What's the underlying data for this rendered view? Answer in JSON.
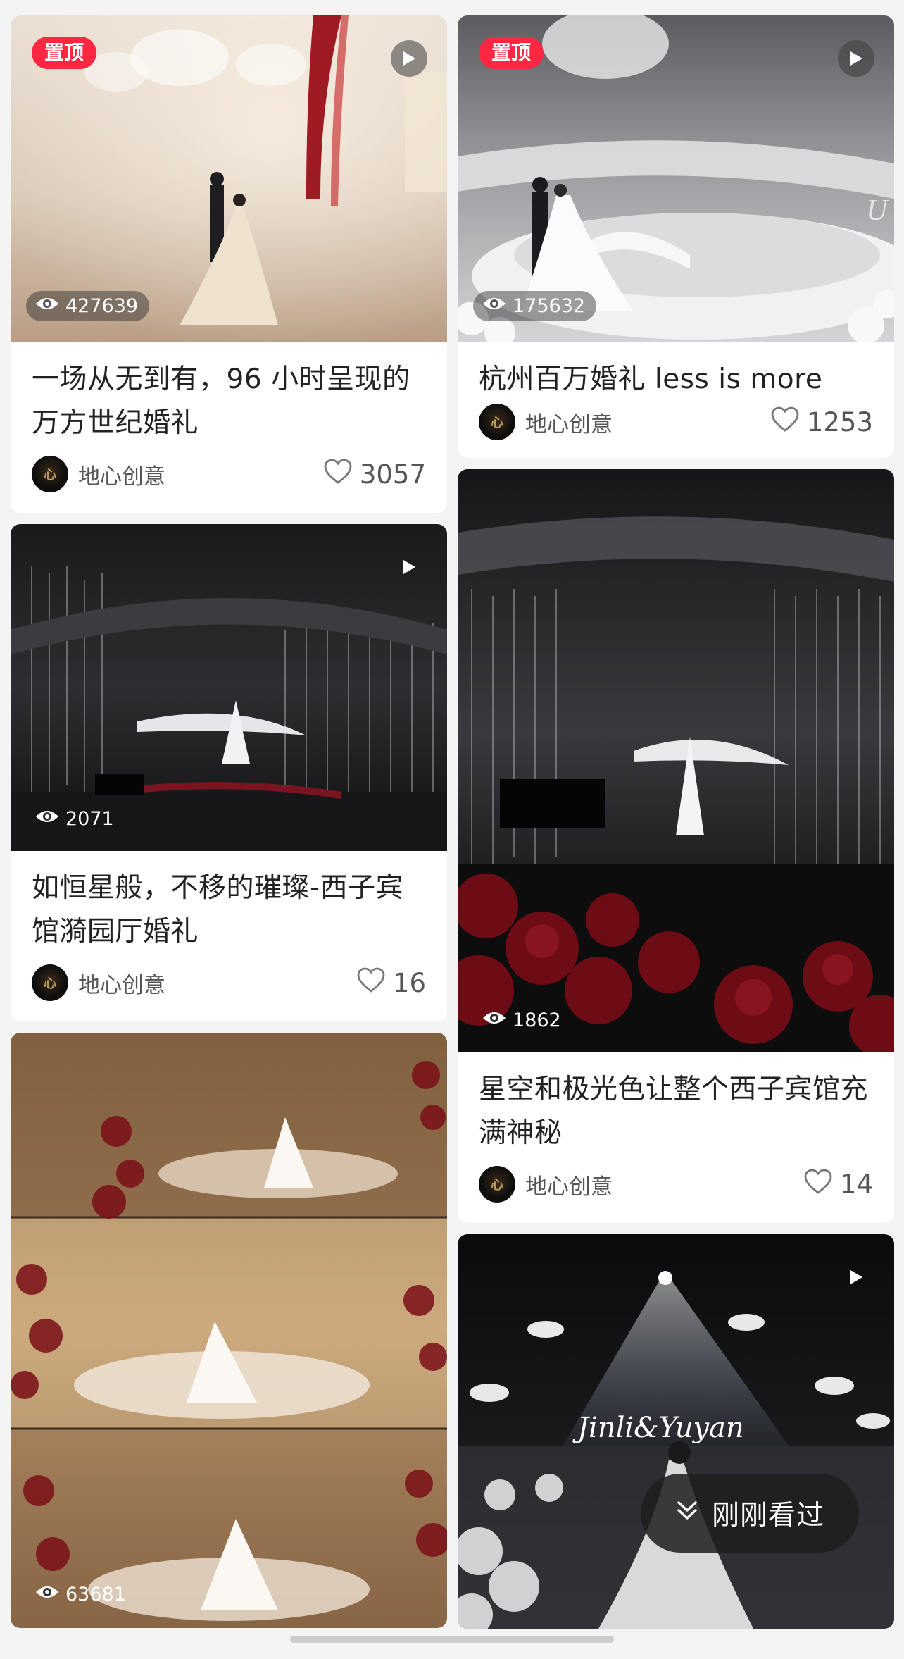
{
  "pinned_label": "置顶",
  "left_column": [
    {
      "pinned": true,
      "views": "427639",
      "title": "一场从无到有，96 小时呈现的万方世纪婚礼",
      "author": "地心创意",
      "likes": "3057"
    },
    {
      "pinned": false,
      "views": "2071",
      "title": "如恒星般，不移的璀璨-西子宾馆漪园厅婚礼",
      "author": "地心创意",
      "likes": "16"
    },
    {
      "pinned": false,
      "views": "63681"
    }
  ],
  "right_column": [
    {
      "pinned": true,
      "views": "175632",
      "title": "杭州百万婚礼 less is more",
      "author": "地心创意",
      "likes": "1253"
    },
    {
      "pinned": false,
      "views": "1862",
      "title": "星空和极光色让整个西子宾馆充满神秘",
      "author": "地心创意",
      "likes": "14"
    },
    {
      "pinned": false,
      "image_text": "Jinli&Yuyan"
    }
  ],
  "recent_button": {
    "label": "刚刚看过"
  },
  "colors": {
    "pin_badge": "#ff2741",
    "card": "#ffffff",
    "background": "#f4f4f4"
  },
  "icons": [
    "play-icon",
    "eye-icon",
    "heart-icon",
    "chevron-down-double-icon"
  ]
}
